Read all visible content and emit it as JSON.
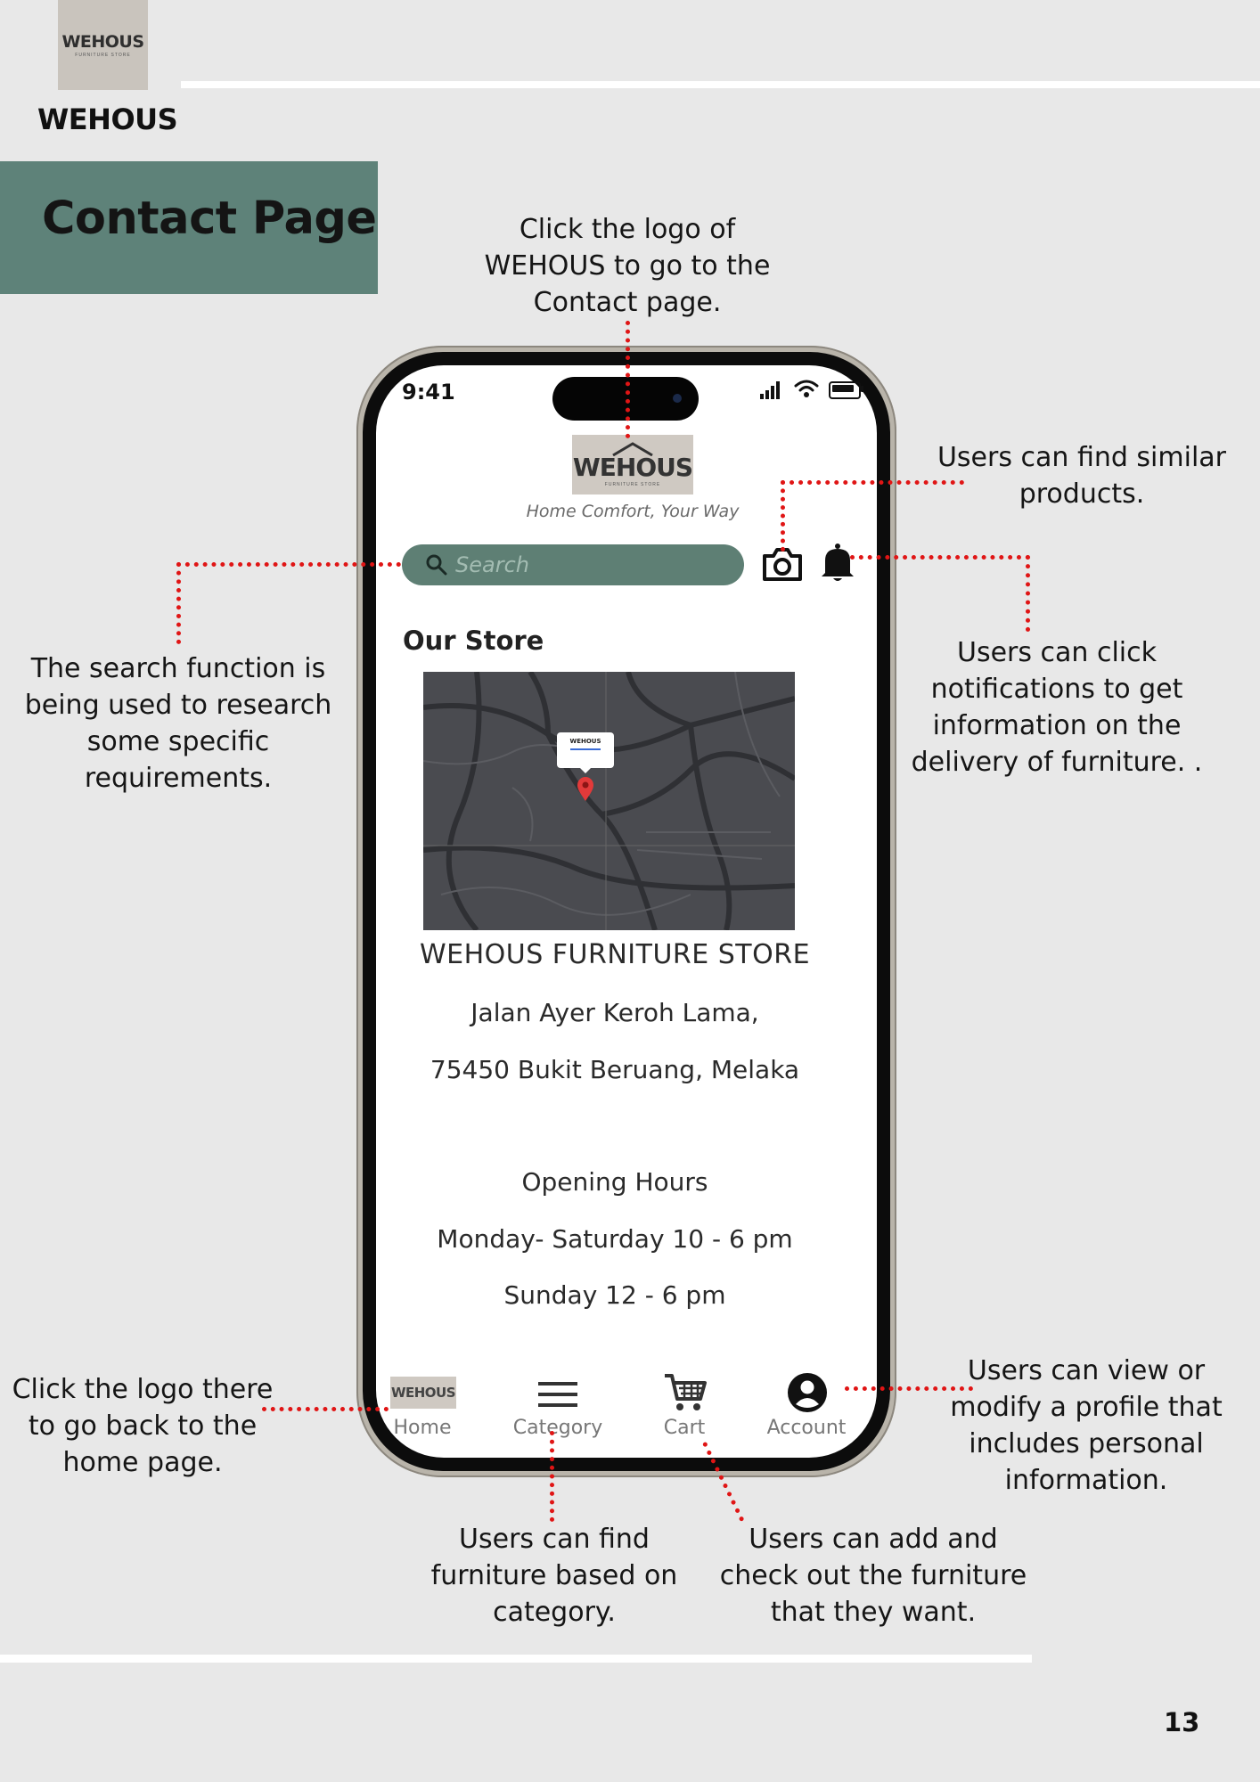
{
  "header": {
    "logo_text": "WEHOUS",
    "logo_subtext": "FURNITURE STORE",
    "brand_name": "WEHOUS",
    "page_title": "Contact Page"
  },
  "annotations": {
    "logo_note": "Click the logo of WEHOUS to go to the Contact page.",
    "camera_note": "Users can find similar products.",
    "search_note": "The search function is being used to research some specific requirements.",
    "notification_note": "Users can click notifications to get information on the delivery of furniture. .",
    "home_note": "Click the logo there to go back to the home page.",
    "account_note": "Users can view or modify a profile that includes personal information.",
    "category_note": "Users can find furniture based on category.",
    "cart_note": "Users can add and check out the furniture that they want."
  },
  "phone": {
    "time": "9:41",
    "app_logo_text": "WEHOUS",
    "tagline": "Home Comfort, Your Way",
    "search_placeholder": "Search",
    "store_heading": "Our Store",
    "map_popup_title": "WEHOUS",
    "store_name": "WEHOUS FURNITURE STORE",
    "address_line1": "Jalan Ayer Keroh Lama,",
    "address_line2": "75450 Bukit Beruang, Melaka",
    "hours_heading": "Opening Hours",
    "hours_weekday": "Monday- Saturday 10 - 6 pm",
    "hours_sunday": "Sunday 12 - 6 pm",
    "tabs": [
      {
        "label": "Home",
        "icon": "home-logo-icon"
      },
      {
        "label": "Category",
        "icon": "menu-icon"
      },
      {
        "label": "Cart",
        "icon": "cart-icon"
      },
      {
        "label": "Account",
        "icon": "account-icon"
      }
    ]
  },
  "colors": {
    "accent": "#5e8279",
    "annotation_line": "#e01515",
    "background": "#e8e8e8"
  },
  "footer": {
    "page_number": "13"
  }
}
